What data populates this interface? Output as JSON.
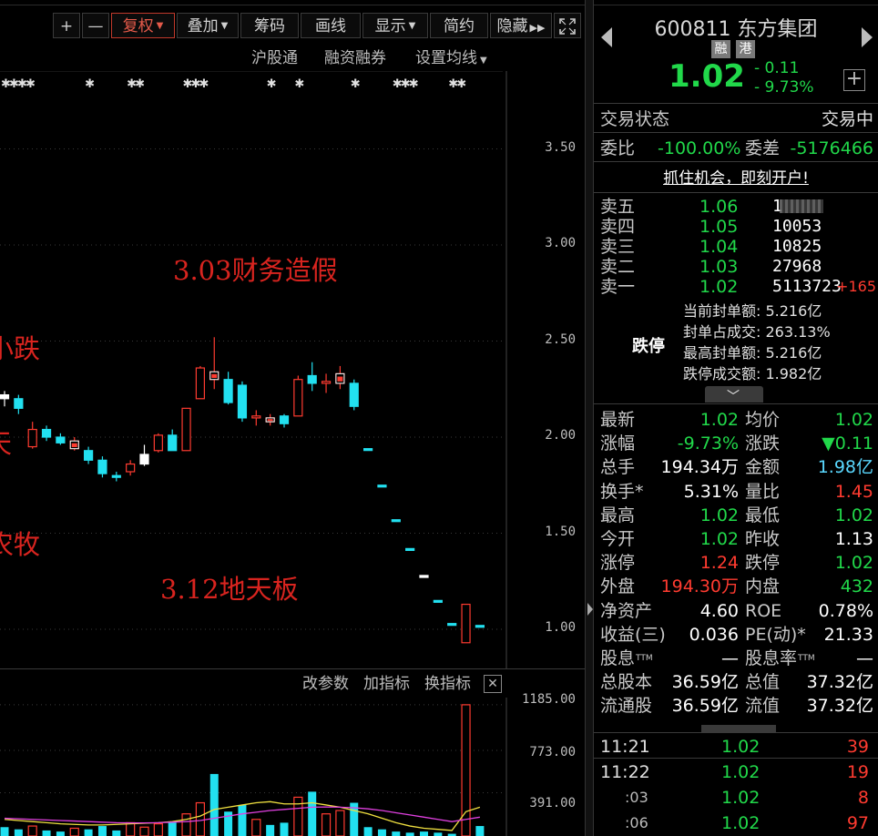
{
  "toolbar": {
    "plus": "+",
    "minus": "—",
    "fuquan": "复权",
    "diejia": "叠加",
    "chouma": "筹码",
    "huaxian": "画线",
    "xianshi": "显示",
    "jianyue": "简约",
    "yincang": "隐藏",
    "expand_icon": "fullscreen-icon"
  },
  "subtoolbar": {
    "hgt": "沪股通",
    "rzrq": "融资融券",
    "ma": "设置均线"
  },
  "annotations": {
    "a1": "3.03财务造假",
    "a2": "3.12地天板",
    "left1": "小跌",
    "left2": "天",
    "left3": "农牧"
  },
  "chart_data": {
    "type": "candlestick",
    "y_ticks": [
      "3.50",
      "3.00",
      "2.50",
      "2.00",
      "1.50",
      "1.00"
    ],
    "ylim": [
      0.9,
      3.6
    ],
    "candles": [
      {
        "o": 2.22,
        "h": 2.24,
        "l": 2.16,
        "c": 2.2,
        "color": "white"
      },
      {
        "o": 2.2,
        "h": 2.22,
        "l": 2.12,
        "c": 2.15,
        "color": "cyan"
      },
      {
        "o": 1.95,
        "h": 2.08,
        "l": 1.94,
        "c": 2.04,
        "color": "red"
      },
      {
        "o": 2.04,
        "h": 2.06,
        "l": 1.98,
        "c": 2.0,
        "color": "cyan"
      },
      {
        "o": 2.0,
        "h": 2.02,
        "l": 1.96,
        "c": 1.97,
        "color": "cyan"
      },
      {
        "o": 1.98,
        "h": 2.0,
        "l": 1.93,
        "c": 1.94,
        "color": "redfill"
      },
      {
        "o": 1.93,
        "h": 1.95,
        "l": 1.86,
        "c": 1.88,
        "color": "cyan"
      },
      {
        "o": 1.88,
        "h": 1.9,
        "l": 1.79,
        "c": 1.81,
        "color": "cyan"
      },
      {
        "o": 1.8,
        "h": 1.82,
        "l": 1.77,
        "c": 1.8,
        "color": "cyan"
      },
      {
        "o": 1.82,
        "h": 1.88,
        "l": 1.8,
        "c": 1.86,
        "color": "red"
      },
      {
        "o": 1.86,
        "h": 1.96,
        "l": 1.85,
        "c": 1.91,
        "color": "white"
      },
      {
        "o": 1.93,
        "h": 2.02,
        "l": 1.92,
        "c": 2.01,
        "color": "red"
      },
      {
        "o": 2.01,
        "h": 2.04,
        "l": 1.93,
        "c": 1.93,
        "color": "cyan"
      },
      {
        "o": 1.93,
        "h": 2.15,
        "l": 1.93,
        "c": 2.15,
        "color": "red"
      },
      {
        "o": 2.2,
        "h": 2.37,
        "l": 2.2,
        "c": 2.36,
        "color": "red"
      },
      {
        "o": 2.34,
        "h": 2.52,
        "l": 2.25,
        "c": 2.3,
        "color": "redfill"
      },
      {
        "o": 2.3,
        "h": 2.34,
        "l": 2.17,
        "c": 2.18,
        "color": "cyan"
      },
      {
        "o": 2.27,
        "h": 2.29,
        "l": 2.08,
        "c": 2.1,
        "color": "cyan"
      },
      {
        "o": 2.11,
        "h": 2.14,
        "l": 2.06,
        "c": 2.1,
        "color": "red"
      },
      {
        "o": 2.1,
        "h": 2.12,
        "l": 2.06,
        "c": 2.08,
        "color": "redfill"
      },
      {
        "o": 2.11,
        "h": 2.12,
        "l": 2.05,
        "c": 2.07,
        "color": "cyan"
      },
      {
        "o": 2.11,
        "h": 2.32,
        "l": 2.11,
        "c": 2.3,
        "color": "red"
      },
      {
        "o": 2.32,
        "h": 2.39,
        "l": 2.24,
        "c": 2.28,
        "color": "cyan"
      },
      {
        "o": 2.28,
        "h": 2.33,
        "l": 2.23,
        "c": 2.29,
        "color": "red"
      },
      {
        "o": 2.33,
        "h": 2.37,
        "l": 2.25,
        "c": 2.28,
        "color": "redfill"
      },
      {
        "o": 2.28,
        "h": 2.3,
        "l": 2.14,
        "c": 2.16,
        "color": "cyan"
      },
      {
        "o": 1.94,
        "h": 1.94,
        "l": 1.94,
        "c": 1.94,
        "color": "cyan"
      },
      {
        "o": 1.75,
        "h": 1.75,
        "l": 1.75,
        "c": 1.75,
        "color": "cyan"
      },
      {
        "o": 1.57,
        "h": 1.57,
        "l": 1.57,
        "c": 1.57,
        "color": "cyan"
      },
      {
        "o": 1.42,
        "h": 1.42,
        "l": 1.42,
        "c": 1.42,
        "color": "cyan"
      },
      {
        "o": 1.28,
        "h": 1.28,
        "l": 1.27,
        "c": 1.27,
        "color": "white"
      },
      {
        "o": 1.15,
        "h": 1.15,
        "l": 1.15,
        "c": 1.15,
        "color": "cyan"
      },
      {
        "o": 1.03,
        "h": 1.03,
        "l": 1.03,
        "c": 1.03,
        "color": "cyan"
      },
      {
        "o": 0.93,
        "h": 1.13,
        "l": 0.93,
        "c": 1.13,
        "color": "red"
      },
      {
        "o": 1.02,
        "h": 1.02,
        "l": 1.02,
        "c": 1.02,
        "color": "cyan"
      }
    ],
    "marker_groups": [
      {
        "candle": 0,
        "count": 4
      },
      {
        "candle": 6,
        "count": 1
      },
      {
        "candle": 9,
        "count": 2
      },
      {
        "candle": 13,
        "count": 3
      },
      {
        "candle": 19,
        "count": 1
      },
      {
        "candle": 21,
        "count": 1
      },
      {
        "candle": 25,
        "count": 1
      },
      {
        "candle": 28,
        "count": 3
      },
      {
        "candle": 32,
        "count": 2
      }
    ]
  },
  "volume": {
    "gaicanshu": "改参数",
    "jiazhibiao": "加指标",
    "huanzhibiao": "换指标",
    "close_icon": "close-icon",
    "ticks": [
      "1185.00",
      "773.00",
      "391.00"
    ]
  },
  "volume_data": {
    "ylim": [
      0,
      1250
    ],
    "bars": [
      {
        "v": 80,
        "color": "cyan"
      },
      {
        "v": 60,
        "color": "cyan"
      },
      {
        "v": 90,
        "color": "red"
      },
      {
        "v": 50,
        "color": "cyan"
      },
      {
        "v": 40,
        "color": "cyan"
      },
      {
        "v": 70,
        "color": "red"
      },
      {
        "v": 60,
        "color": "cyan"
      },
      {
        "v": 90,
        "color": "cyan"
      },
      {
        "v": 50,
        "color": "cyan"
      },
      {
        "v": 120,
        "color": "red"
      },
      {
        "v": 80,
        "color": "red"
      },
      {
        "v": 110,
        "color": "red"
      },
      {
        "v": 130,
        "color": "cyan"
      },
      {
        "v": 200,
        "color": "red"
      },
      {
        "v": 300,
        "color": "red"
      },
      {
        "v": 560,
        "color": "cyan"
      },
      {
        "v": 220,
        "color": "cyan"
      },
      {
        "v": 280,
        "color": "cyan"
      },
      {
        "v": 150,
        "color": "red"
      },
      {
        "v": 100,
        "color": "cyan"
      },
      {
        "v": 120,
        "color": "cyan"
      },
      {
        "v": 350,
        "color": "red"
      },
      {
        "v": 400,
        "color": "cyan"
      },
      {
        "v": 200,
        "color": "red"
      },
      {
        "v": 230,
        "color": "red"
      },
      {
        "v": 300,
        "color": "cyan"
      },
      {
        "v": 80,
        "color": "cyan"
      },
      {
        "v": 60,
        "color": "cyan"
      },
      {
        "v": 40,
        "color": "cyan"
      },
      {
        "v": 30,
        "color": "cyan"
      },
      {
        "v": 40,
        "color": "cyan"
      },
      {
        "v": 30,
        "color": "cyan"
      },
      {
        "v": 20,
        "color": "cyan"
      },
      {
        "v": 1185,
        "color": "red"
      },
      {
        "v": 90,
        "color": "cyan"
      }
    ],
    "ma1": [
      150,
      140,
      130,
      120,
      110,
      105,
      100,
      100,
      105,
      110,
      115,
      120,
      130,
      150,
      180,
      240,
      260,
      280,
      300,
      310,
      290,
      290,
      300,
      280,
      260,
      230,
      200,
      160,
      120,
      90,
      70,
      60,
      50,
      220,
      260
    ],
    "ma2": [
      160,
      155,
      150,
      145,
      140,
      135,
      130,
      125,
      120,
      118,
      118,
      120,
      125,
      130,
      140,
      160,
      180,
      200,
      215,
      230,
      240,
      250,
      260,
      262,
      260,
      255,
      245,
      230,
      210,
      190,
      170,
      150,
      130,
      150,
      170
    ]
  },
  "quote": {
    "code_name": "600811 东方集团",
    "tag1": "融",
    "tag2": "港",
    "price": "1.02",
    "chg_abs": "- 0.11",
    "chg_pct": "- 9.73%",
    "add_icon": "plus-icon",
    "prev_icon": "prev-stock-icon",
    "next_icon": "next-stock-icon",
    "trade_state_label": "交易状态",
    "trade_state_value": "交易中",
    "weibi_label": "委比",
    "weibi_value": "-100.00%",
    "weicha_label": "委差",
    "weicha_value": "-5176466",
    "promo": "抓住机会，即刻开户!"
  },
  "orderbook": [
    {
      "name": "卖五",
      "price": "1.06",
      "vol": "1",
      "delta": ""
    },
    {
      "name": "卖四",
      "price": "1.05",
      "vol": "10053",
      "delta": ""
    },
    {
      "name": "卖三",
      "price": "1.04",
      "vol": "10825",
      "delta": ""
    },
    {
      "name": "卖二",
      "price": "1.03",
      "vol": "27968",
      "delta": ""
    },
    {
      "name": "卖一",
      "price": "1.02",
      "vol": "5113723",
      "delta": "+165"
    }
  ],
  "limit": {
    "label": "跌停",
    "rows": [
      "当前封单额: 5.216亿",
      "封单占成交: 263.13%",
      "最高封单额: 5.216亿",
      "跌停成交额: 1.982亿"
    ]
  },
  "stats": [
    {
      "k1": "最新",
      "v1": "1.02",
      "c1": "grn",
      "k2": "均价",
      "v2": "1.02",
      "c2": "grn"
    },
    {
      "k1": "涨幅",
      "v1": "-9.73%",
      "c1": "grn",
      "k2": "涨跌",
      "v2": "▼0.11",
      "c2": "grn"
    },
    {
      "k1": "总手",
      "v1": "194.34万",
      "c1": "wht",
      "k2": "金额",
      "v2": "1.98亿",
      "c2": "cyan"
    },
    {
      "k1": "换手*",
      "v1": "5.31%",
      "c1": "wht",
      "k2": "量比",
      "v2": "1.45",
      "c2": "red"
    },
    {
      "k1": "最高",
      "v1": "1.02",
      "c1": "grn",
      "k2": "最低",
      "v2": "1.02",
      "c2": "grn"
    },
    {
      "k1": "今开",
      "v1": "1.02",
      "c1": "grn",
      "k2": "昨收",
      "v2": "1.13",
      "c2": "wht"
    },
    {
      "k1": "涨停",
      "v1": "1.24",
      "c1": "red",
      "k2": "跌停",
      "v2": "1.02",
      "c2": "grn"
    },
    {
      "k1": "外盘",
      "v1": "194.30万",
      "c1": "red",
      "k2": "内盘",
      "v2": "432",
      "c2": "grn"
    },
    {
      "k1": "净资产",
      "v1": "4.60",
      "c1": "wht",
      "k2": "ROE",
      "v2": "0.78%",
      "c2": "wht"
    },
    {
      "k1": "收益(三)",
      "v1": "0.036",
      "c1": "wht",
      "k2": "PE(动)*",
      "v2": "21.33",
      "c2": "wht"
    },
    {
      "k1": "股息",
      "v1": "—",
      "c1": "wht",
      "k2": "股息率",
      "v2": "—",
      "c2": "wht"
    },
    {
      "k1": "总股本",
      "v1": "36.59亿",
      "c1": "wht",
      "k2": "总值",
      "v2": "37.32亿",
      "c2": "wht"
    },
    {
      "k1": "流通股",
      "v1": "36.59亿",
      "c1": "wht",
      "k2": "流值",
      "v2": "37.32亿",
      "c2": "wht"
    }
  ],
  "ticks": [
    {
      "t": "11:21",
      "p": "1.02",
      "v": "39",
      "sub": false
    },
    {
      "t": "11:22",
      "p": "1.02",
      "v": "19",
      "sub": false
    },
    {
      "t": ":03",
      "p": "1.02",
      "v": "8",
      "sub": true
    },
    {
      "t": ":06",
      "p": "1.02",
      "v": "97",
      "sub": true
    }
  ],
  "colors": {
    "up": "#ff3b30",
    "down_cyan": "#22e0f0",
    "green": "#21d84a",
    "annotation": "#d8241f"
  }
}
